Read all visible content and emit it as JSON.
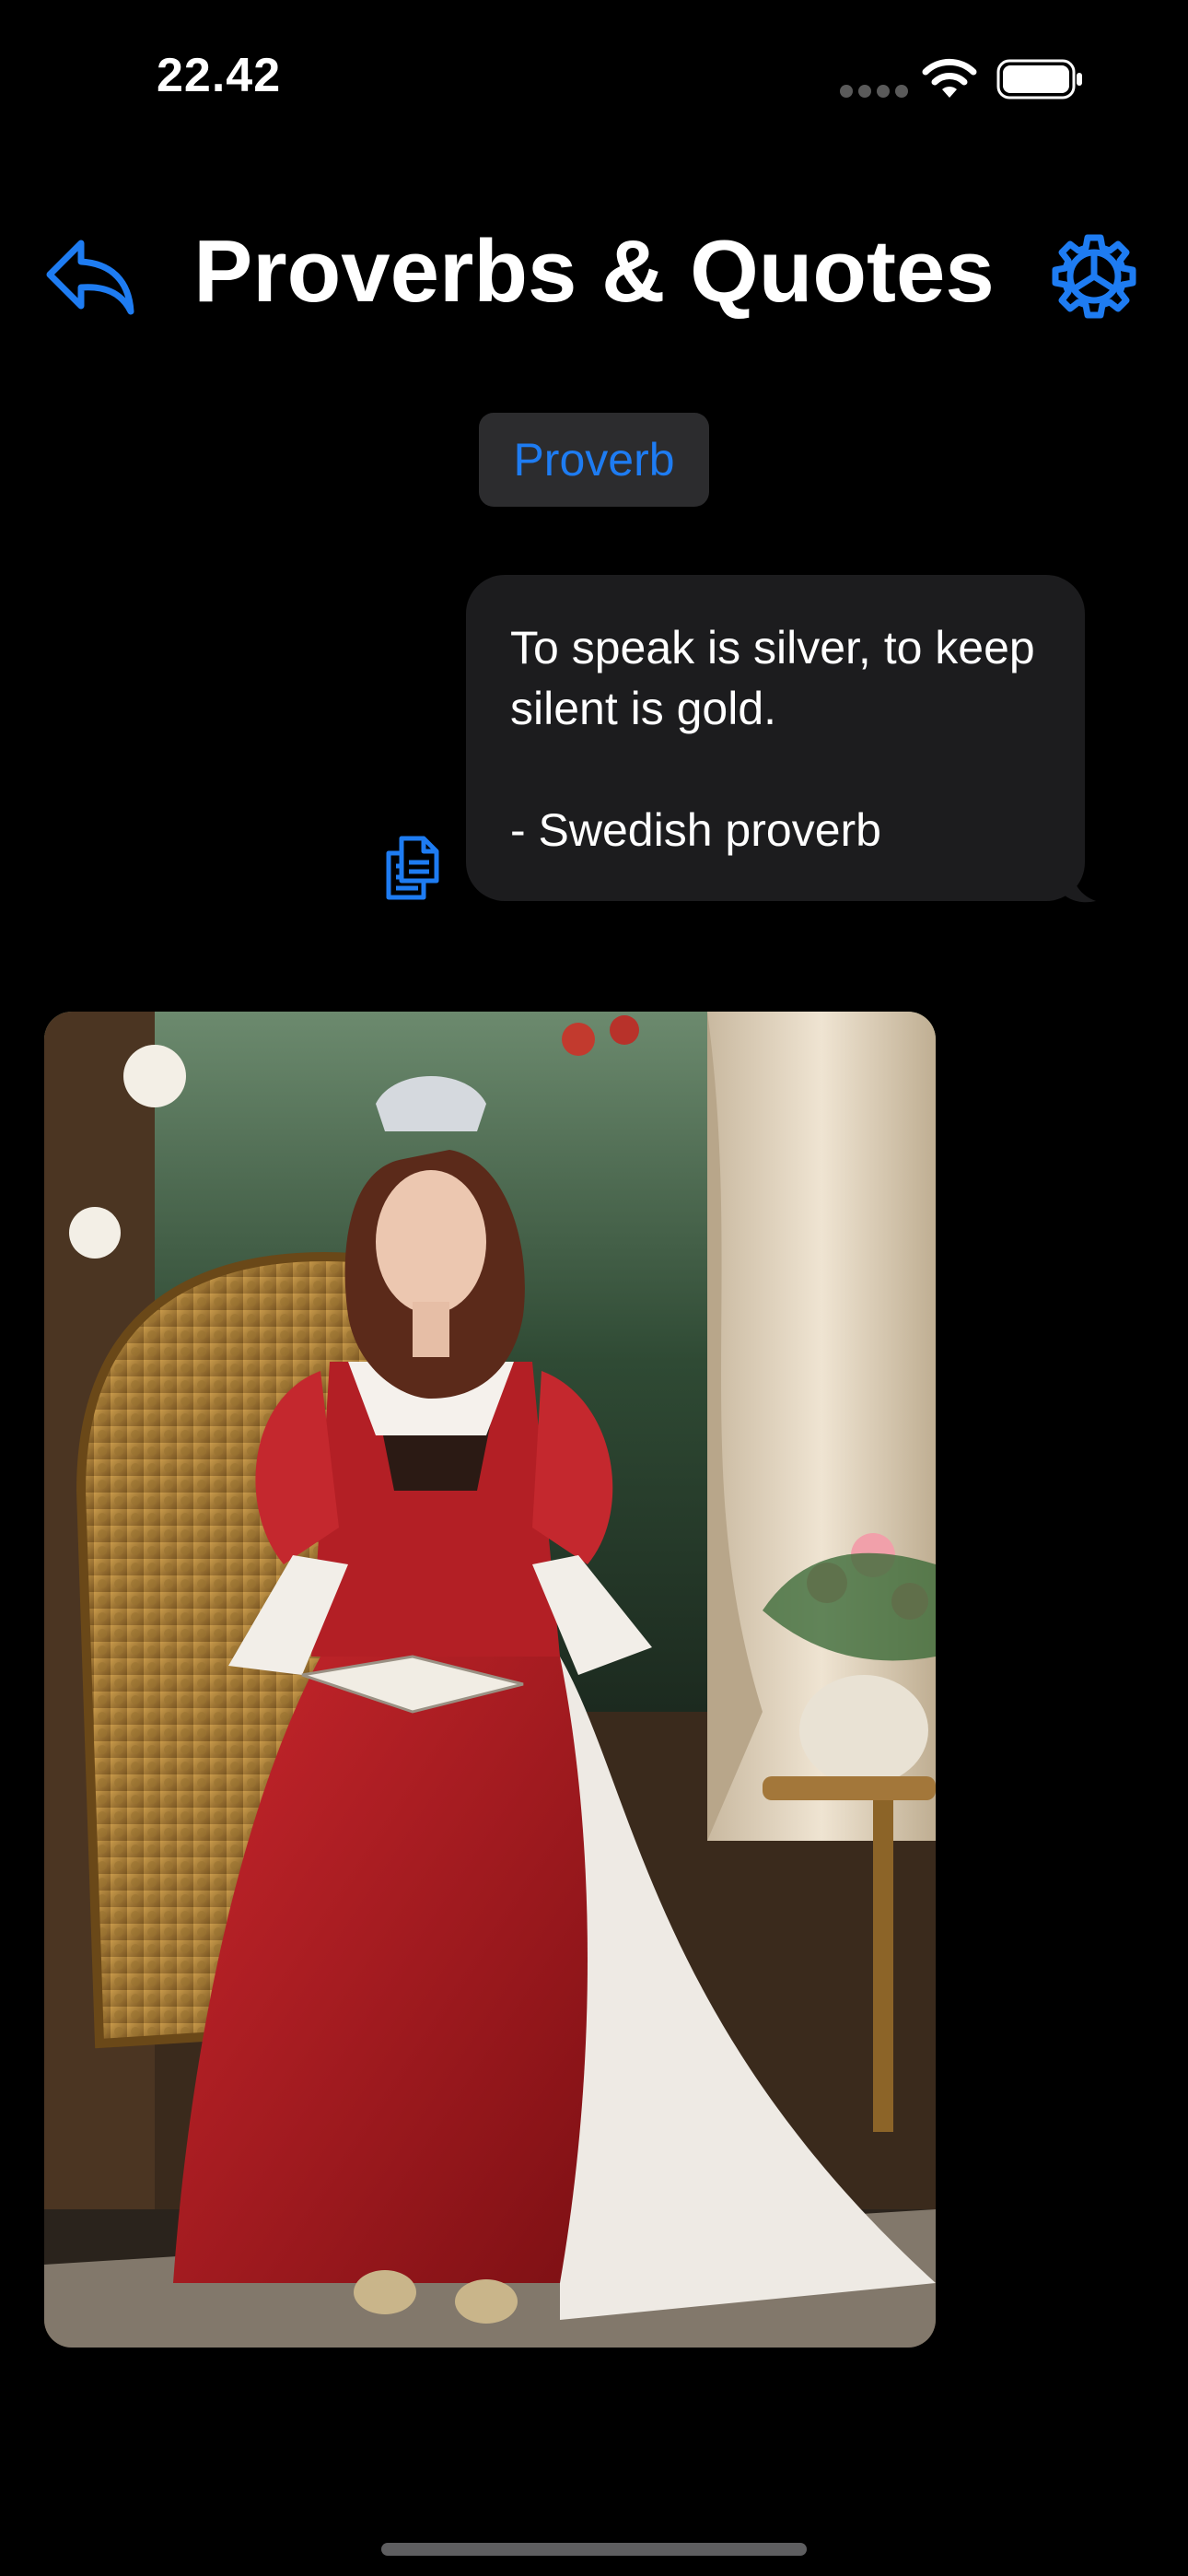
{
  "status_bar": {
    "time": "22.42"
  },
  "header": {
    "title": "Proverbs & Quotes"
  },
  "chip": {
    "label": "Proverb"
  },
  "message": {
    "text": "To speak is silver, to keep\nsilent is gold.\n\n- Swedish proverb"
  },
  "icons": {
    "back": "reply-arrow-icon",
    "settings": "gear-icon",
    "copy": "copy-icon",
    "wifi": "wifi-icon",
    "battery": "battery-icon"
  },
  "colors": {
    "accent": "#1e7cf2",
    "background": "#000000",
    "bubble": "#1c1c1e",
    "chip": "#2c2c2e"
  },
  "image": {
    "subject": "portrait painting of a woman in a red and white dress seated in a wicker chair"
  }
}
